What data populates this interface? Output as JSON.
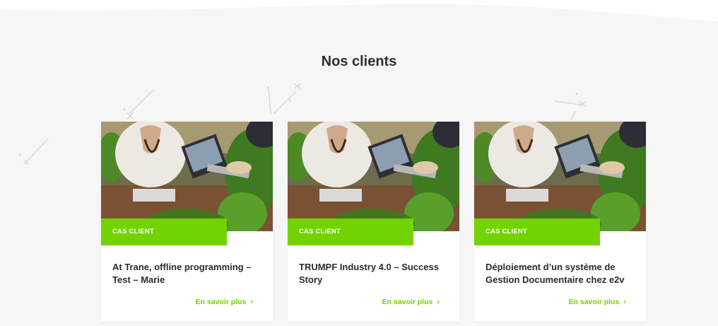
{
  "section": {
    "title": "Nos clients"
  },
  "accent_color": "#72d300",
  "cards": [
    {
      "tag": "CAS CLIENT",
      "title": "At Trane, offline programming – Test – Marie",
      "link_label": "En savoir plus",
      "link_icon": "chevron-right-icon"
    },
    {
      "tag": "CAS CLIENT",
      "title": "TRUMPF Industry 4.0 – Success Story",
      "link_label": "En savoir plus",
      "link_icon": "chevron-right-icon"
    },
    {
      "tag": "CAS CLIENT",
      "title": "Déploiement d’un système de Gestion Documentaire chez e2v",
      "link_label": "En savoir plus",
      "link_icon": "chevron-right-icon"
    }
  ]
}
